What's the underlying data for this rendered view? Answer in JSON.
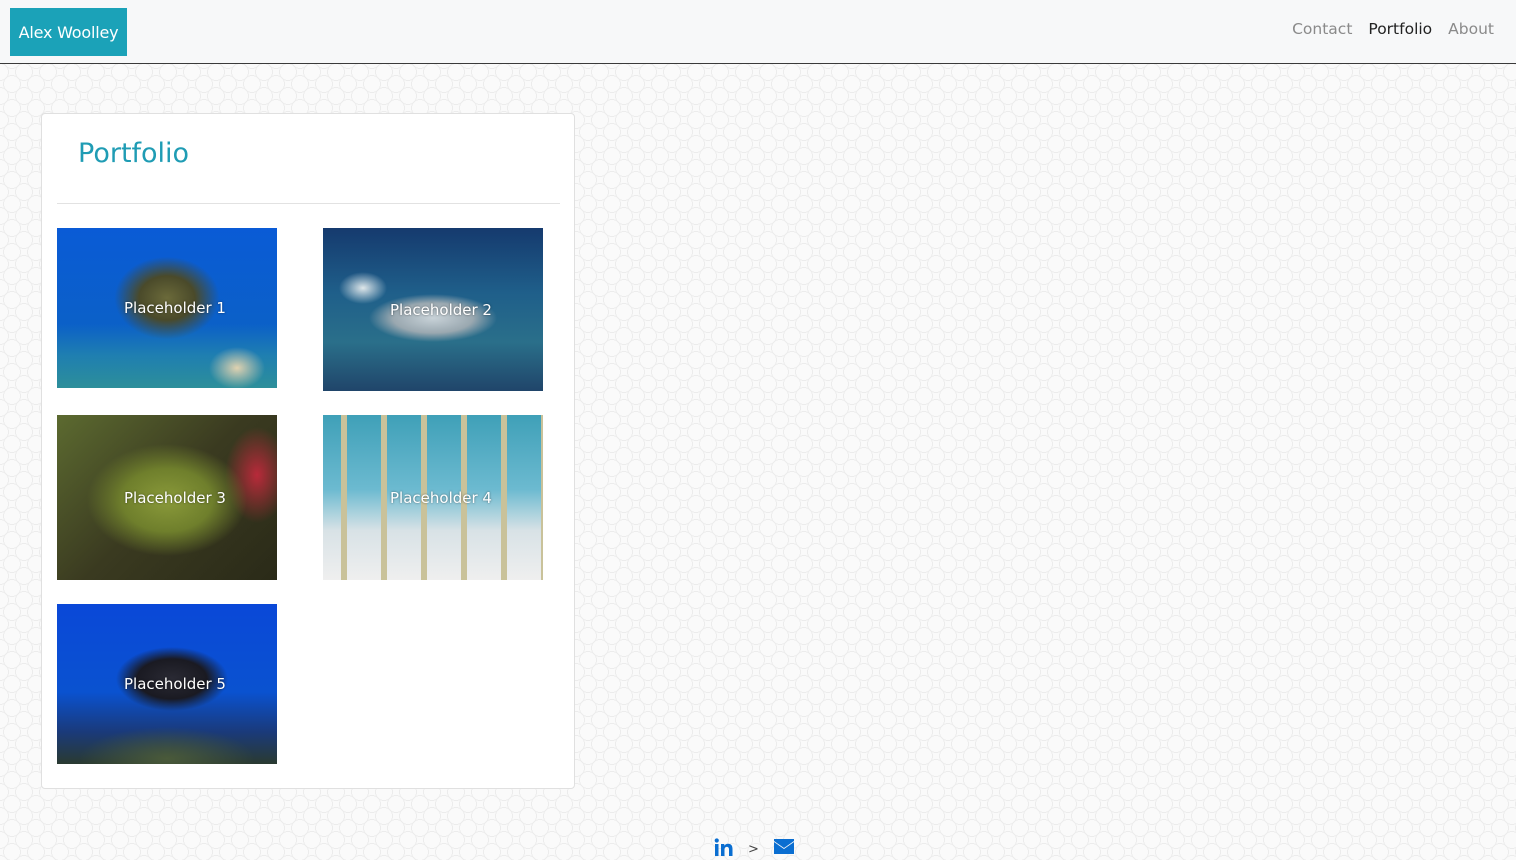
{
  "header": {
    "brand": "Alex Woolley",
    "nav": [
      {
        "label": "Contact"
      },
      {
        "label": "Portfolio"
      },
      {
        "label": "About"
      }
    ]
  },
  "portfolio": {
    "title": "Portfolio",
    "items": [
      {
        "caption": "Placeholder 1"
      },
      {
        "caption": "Placeholder 2"
      },
      {
        "caption": "Placeholder 3"
      },
      {
        "caption": "Placeholder 4"
      },
      {
        "caption": "Placeholder 5"
      }
    ]
  },
  "footer": {
    "separator": ">",
    "icons": [
      "linkedin-icon",
      "envelope-icon"
    ]
  },
  "colors": {
    "brand": "#1ba2b8",
    "title": "#1f9cb4",
    "icon": "#0a6ed1"
  }
}
